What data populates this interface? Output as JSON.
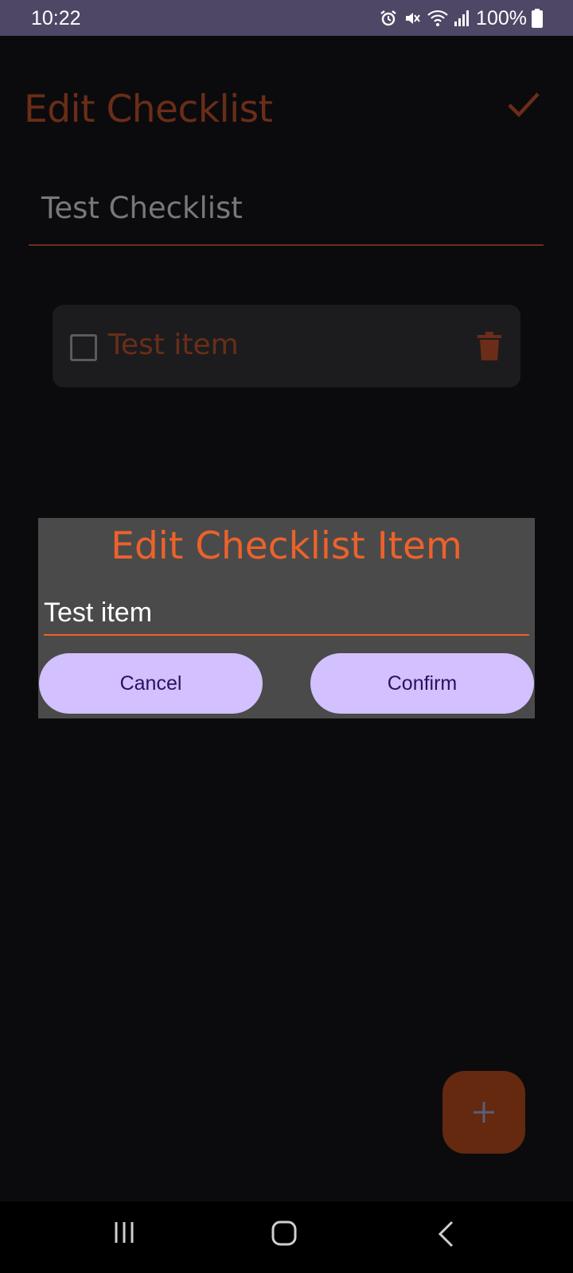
{
  "status_bar": {
    "time": "10:22",
    "battery": "100%",
    "icons": [
      "alarm-icon",
      "mute-icon",
      "wifi-icon",
      "signal-icon",
      "battery-icon"
    ]
  },
  "app_bar": {
    "title": "Edit Checklist",
    "confirm_icon": "check-icon"
  },
  "checklist": {
    "title_value": "Test Checklist",
    "items": [
      {
        "label": "Test item",
        "checked": false
      }
    ]
  },
  "dialog": {
    "title": "Edit Checklist Item",
    "input_value": "Test item",
    "cancel_label": "Cancel",
    "confirm_label": "Confirm"
  },
  "fab": {
    "icon": "plus-icon"
  },
  "colors": {
    "accent": "#ec622b",
    "accent_dim": "#6b2d18",
    "button_bg": "#d2c0ff",
    "button_text": "#2a1060",
    "dialog_bg": "#4a4a4a",
    "background": "#0b0b0d",
    "status_bar": "#4f4766"
  },
  "nav_bar": {
    "icons": [
      "recents-icon",
      "home-icon",
      "back-icon"
    ]
  }
}
